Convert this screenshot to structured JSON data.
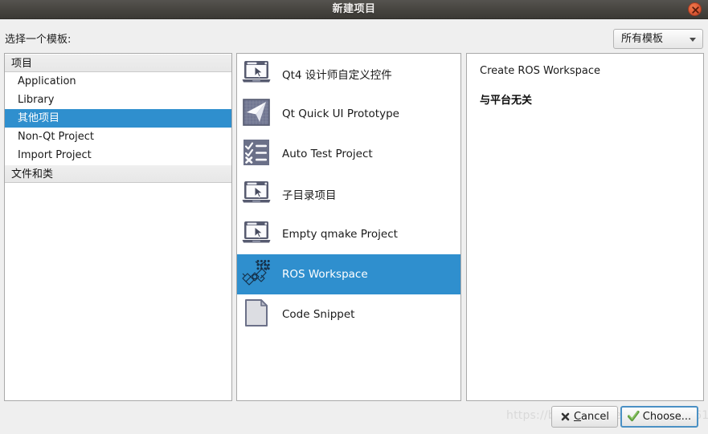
{
  "window": {
    "title": "新建项目",
    "close_icon": "close-x-icon"
  },
  "toolbar": {
    "choose_template_label": "选择一个模板:",
    "filter_value": "所有模板",
    "filter_arrow_icon": "chevron-down-icon"
  },
  "categories": [
    {
      "type": "header",
      "label": "项目"
    },
    {
      "type": "item",
      "label": "Application",
      "selected": false
    },
    {
      "type": "item",
      "label": "Library",
      "selected": false
    },
    {
      "type": "item",
      "label": "其他项目",
      "selected": true
    },
    {
      "type": "item",
      "label": "Non-Qt Project",
      "selected": false
    },
    {
      "type": "item",
      "label": "Import Project",
      "selected": false
    },
    {
      "type": "header",
      "label": "文件和类"
    }
  ],
  "templates": [
    {
      "label": "Qt4 设计师自定义控件",
      "icon": "laptop-cursor-icon",
      "selected": false
    },
    {
      "label": "Qt Quick UI Prototype",
      "icon": "paper-plane-grid-icon",
      "selected": false
    },
    {
      "label": "Auto Test Project",
      "icon": "checklist-icon",
      "selected": false
    },
    {
      "label": "子目录项目",
      "icon": "laptop-cursor-icon",
      "selected": false
    },
    {
      "label": "Empty qmake Project",
      "icon": "laptop-cursor-icon",
      "selected": false
    },
    {
      "label": "ROS Workspace",
      "icon": "robot-arm-icon",
      "selected": true
    },
    {
      "label": "Code Snippet",
      "icon": "document-page-icon",
      "selected": false
    }
  ],
  "description": {
    "title": "Create ROS Workspace",
    "platform": "与平台无关"
  },
  "buttons": {
    "cancel_label": "Cancel",
    "cancel_icon": "cancel-x-icon",
    "choose_label": "Choose...",
    "choose_icon": "green-check-icon"
  },
  "watermark": {
    "text": "https://blog.csdn.net/qq_00100461"
  },
  "colors": {
    "selection_blue": "#2f8fce",
    "titlebar_dark": "#46443f",
    "dialog_bg": "#efefef",
    "close_red": "#e0603a",
    "focus_blue": "#4a90c4",
    "check_green": "#6aa84f"
  }
}
